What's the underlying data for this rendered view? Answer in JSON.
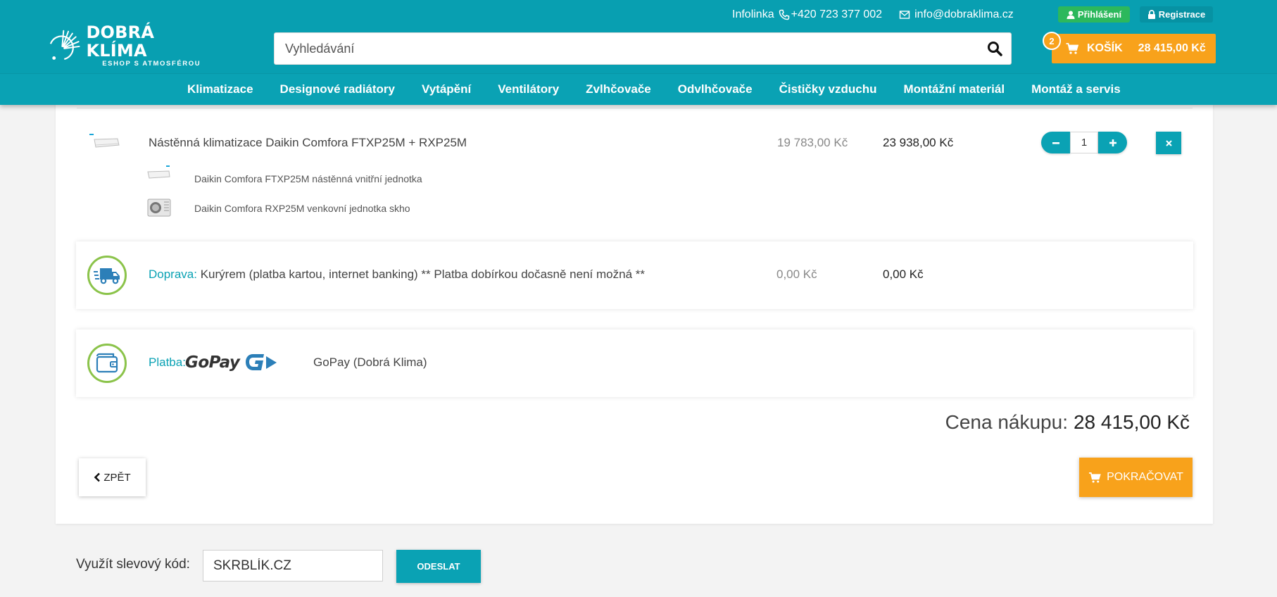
{
  "header": {
    "logo": {
      "title": "DOBRÁ KLÍMA",
      "subtitle": "ESHOP S ATMOSFÉROU"
    },
    "infoline_label": "Infolinka",
    "phone": "+420 723 377 002",
    "email": "info@dobraklima.cz",
    "login_label": "Přihlášení",
    "register_label": "Registrace",
    "search_placeholder": "Vyhledávání",
    "cart": {
      "label": "KOŠÍK",
      "total": "28 415,00 Kč",
      "count": "2"
    },
    "colors": {
      "primary": "#089fb1",
      "accent": "#f8a21b",
      "login": "#2cb85c"
    }
  },
  "nav": [
    "Klimatizace",
    "Designové radiátory",
    "Vytápění",
    "Ventilátory",
    "Zvlhčovače",
    "Odvlhčovače",
    "Čističky vzduchu",
    "Montážní materiál",
    "Montáž a servis"
  ],
  "cart_items": [
    {
      "name": "Nástěnná klimatizace Daikin Comfora FTXP25M + RXP25M",
      "unit_price": "19 783,00 Kč",
      "total_price": "23 938,00 Kč",
      "quantity": "1",
      "components": [
        {
          "name": "Daikin Comfora FTXP25M nástěnná vnitřní jednotka"
        },
        {
          "name": "Daikin Comfora RXP25M venkovní jednotka skho"
        }
      ]
    }
  ],
  "shipping": {
    "label": "Doprava:",
    "text": "Kurýrem (platba kartou, internet banking) ** Platba dobírkou dočasně není možná **",
    "unit_price": "0,00 Kč",
    "total_price": "0,00 Kč"
  },
  "payment": {
    "label": "Platba:",
    "logo_text": "GoPay",
    "provider": "GoPay (Dobrá Klima)"
  },
  "summary": {
    "label": "Cena nákupu:",
    "total": "28 415,00 Kč"
  },
  "buttons": {
    "back": "ZPĚT",
    "continue": "POKRAČOVAT"
  },
  "discount": {
    "label": "Využít slevový kód:",
    "value": "SKRBLÍK.CZ",
    "submit": "ODESLAT"
  }
}
